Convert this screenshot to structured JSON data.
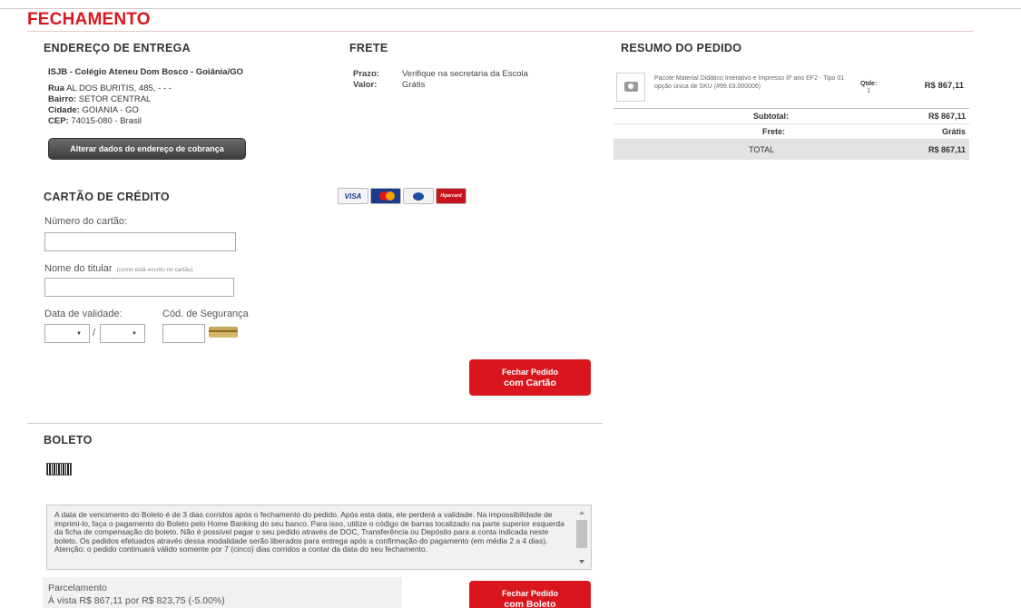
{
  "title": "FECHAMENTO",
  "endereco": {
    "heading": "ENDEREÇO DE ENTREGA",
    "school": "ISJB - Colégio Ateneu Dom Bosco - Goiânia/GO",
    "rua_label": "Rua",
    "rua": "AL DOS BURITIS, 485, - - -",
    "bairro_label": "Bairro:",
    "bairro": "SETOR CENTRAL",
    "cidade_label": "Cidade:",
    "cidade": "GOIANIA - GO",
    "cep_label": "CEP:",
    "cep": "74015-080 - Brasil",
    "button": "Alterar dados do endereço de cobrança"
  },
  "frete": {
    "heading": "FRETE",
    "prazo_label": "Prazo:",
    "prazo": "Verifique na secretaria da Escola",
    "valor_label": "Valor:",
    "valor": "Grátis"
  },
  "resumo": {
    "heading": "RESUMO DO PEDIDO",
    "product_name": "Pacote Material Didático Interativo e Impresso 8º ano EF2 - Tipo 01",
    "product_sku": "opção única de SKU (#99.03.000006)",
    "qtde_label": "Qtde:",
    "qtde": "1",
    "product_price": "R$ 867,11",
    "subtotal_label": "Subtotal:",
    "subtotal": "R$ 867,11",
    "frete_label": "Frete:",
    "frete": "Grátis",
    "total_label": "TOTAL",
    "total": "R$ 867,11"
  },
  "cartao": {
    "heading": "CARTÃO DE CRÉDITO",
    "brands": [
      "VISA",
      "Mastercard",
      "Diners Club",
      "Hipercard"
    ],
    "numero_label": "Número do cartão:",
    "nome_label": "Nome do titular",
    "nome_hint": "(como está escrito no cartão)",
    "validade_label": "Data de validade:",
    "slash": "/",
    "cvv_label": "Cód. de Segurança",
    "button_line1": "Fechar Pedido",
    "button_line2": "com Cartão"
  },
  "boleto": {
    "heading": "BOLETO",
    "terms": "A data de vencimento do Boleto é de 3 dias corridos após o fechamento do pedido. Após esta data, ele perderá a validade. Na impossibilidade de imprimi-lo, faça o pagamento do Boleto pelo Home Banking do seu banco. Para isso, utilize o código de barras localizado na parte superior esquerda da ficha de compensação do boleto. Não é possível pagar o seu pedido através de DOC, Transferência ou Depósito para a conta indicada neste boleto. Os pedidos efetuados através dessa modalidade serão liberados para entrega após a confirmação do pagamento (em média 2 a 4 dias). Atenção: o pedido continuará válido somente por 7 (cinco) dias corridos a contar da data do seu fechamento.",
    "parcel_label": "Parcelamento",
    "parcel_value": "À vista R$ 867,11 por R$ 823,75 (-5.00%)",
    "button_line1": "Fechar Pedido",
    "button_line2": "com Boleto"
  }
}
